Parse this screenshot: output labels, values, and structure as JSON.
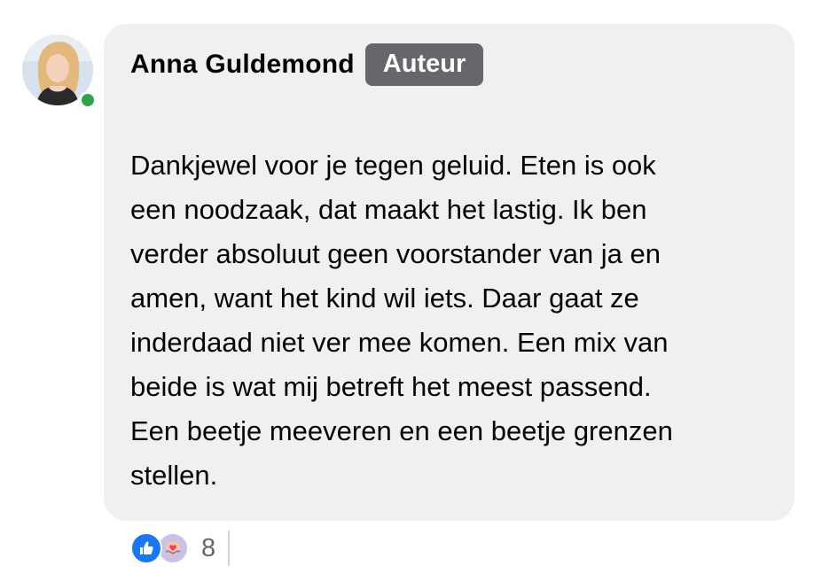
{
  "comment": {
    "author": "Anna Guldemond",
    "badge": "Auteur",
    "text": "Dankjewel voor je tegen geluid. Eten is ook\neen noodzaak, dat maakt het lastig. Ik ben\nverder absoluut geen voorstander van ja en\namen, want het kind wil iets. Daar gaat ze\ninderdaad niet ver mee komen. Een mix van\nbeide is wat mij betreft het meest passend.\nEen beetje meeveren en een beetje grenzen\nstellen.",
    "online": true
  },
  "reactions": {
    "icons": [
      "like-icon",
      "care-icon"
    ],
    "count": "8"
  },
  "colors": {
    "bubble": "#f0f0f0",
    "badge": "#65676b",
    "online": "#31a24c",
    "like": "#1877f2"
  }
}
